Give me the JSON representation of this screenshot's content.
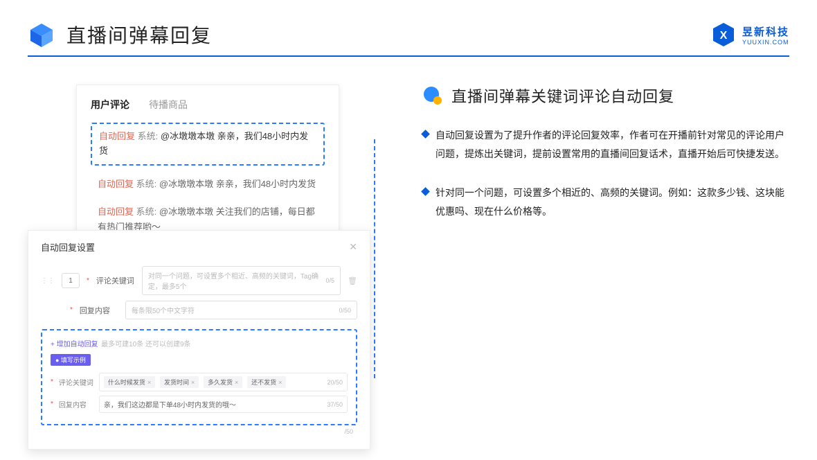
{
  "header": {
    "title": "直播间弹幕回复",
    "brand_cn": "昱新科技",
    "brand_en": "YUUXIN.COM"
  },
  "comments": {
    "tab_active": "用户评论",
    "tab_inactive": "待播商品",
    "auto_label": "自动回复",
    "sys_label": "系统:",
    "row1": "@冰墩墩本墩 亲亲，我们48小时内发货",
    "row2": "@冰墩墩本墩 亲亲，我们48小时内发货",
    "row3": "@冰墩墩本墩 关注我们的店铺，每日都有热门推荐哟～"
  },
  "settings": {
    "title": "自动回复设置",
    "number": "1",
    "kw_label": "评论关键词",
    "kw_placeholder": "对同一个问题，可设置多个相近、高频的关键词，Tag确定，最多5个",
    "kw_counter": "0/5",
    "content_label": "回复内容",
    "content_placeholder": "每条限50个中文字符",
    "content_counter": "0/50",
    "add_link": "+ 增加自动回复",
    "add_hint": "最多可建10条 还可以创建9条",
    "example_badge": "● 填写示例",
    "ex_kw_label": "评论关键词",
    "ex_tags": [
      "什么时候发货",
      "发货时间",
      "多久发货",
      "还不发货"
    ],
    "ex_kw_counter": "20/50",
    "ex_content_label": "回复内容",
    "ex_content_value": "亲，我们这边都是下单48小时内发货的哦～",
    "ex_content_counter": "37/50",
    "trailing": "/50"
  },
  "right": {
    "title": "直播间弹幕关键词评论自动回复",
    "bullet1": "自动回复设置为了提升作者的评论回复效率，作者可在开播前针对常见的评论用户问题，提炼出关键词，提前设置常用的直播间回复话术，直播开始后可快捷发送。",
    "bullet2": "针对同一个问题，可设置多个相近的、高频的关键词。例如：这款多少钱、这块能优惠吗、现在什么价格等。"
  }
}
